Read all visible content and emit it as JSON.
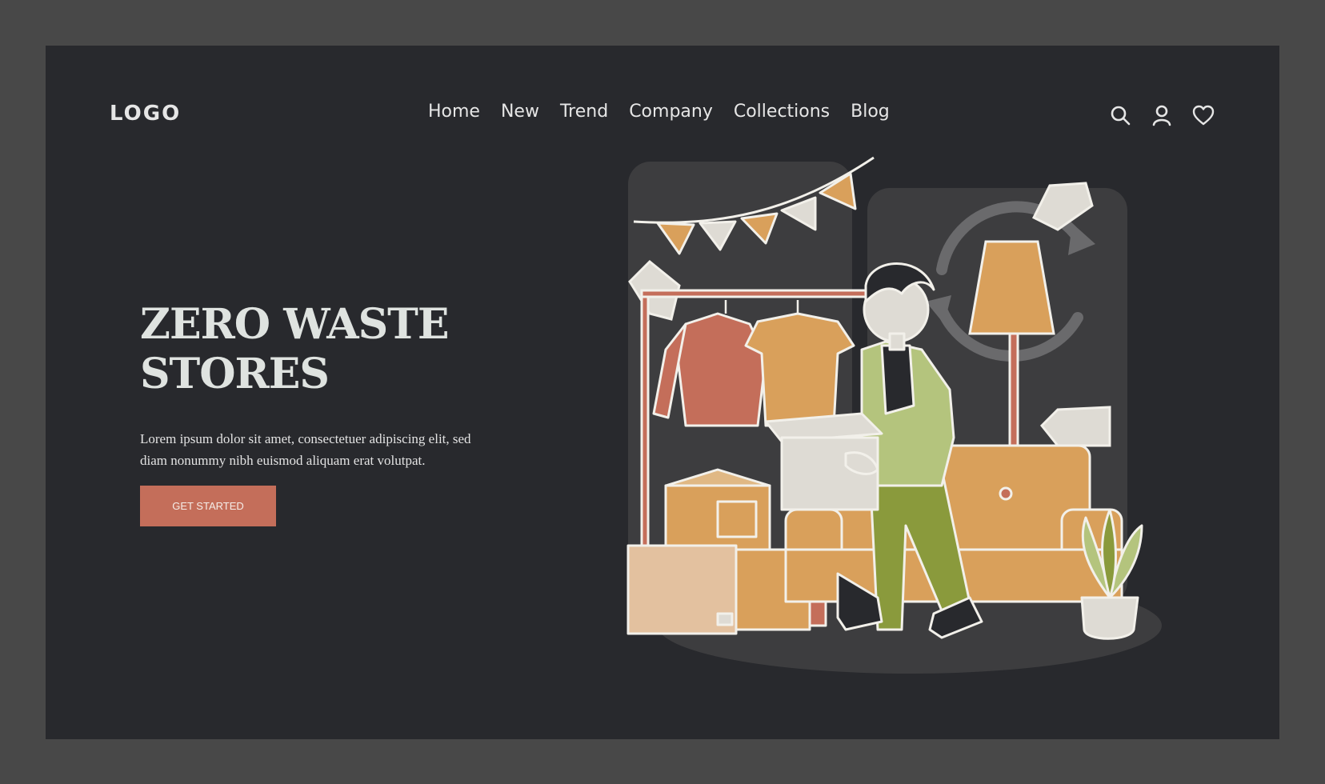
{
  "header": {
    "logo": "LOGO",
    "nav": [
      "Home",
      "New",
      "Trend",
      "Company",
      "Collections",
      "Blog"
    ],
    "icons": [
      "search-icon",
      "user-icon",
      "heart-icon"
    ]
  },
  "hero": {
    "title_line1": "ZERO WASTE",
    "title_line2": "STORES",
    "text_line1": "Lorem ipsum dolor sit amet, consectetuer adipiscing elit, sed",
    "text_line2": "diam nonummy nibh euismod aliquam erat volutpat.",
    "cta_label": "GET STARTED"
  },
  "colors": {
    "background": "#28292d",
    "frame": "#484848",
    "accent": "#c46e5a",
    "mustard": "#d9a05b",
    "olive": "#8a9a3c",
    "sage": "#b4c47d"
  }
}
